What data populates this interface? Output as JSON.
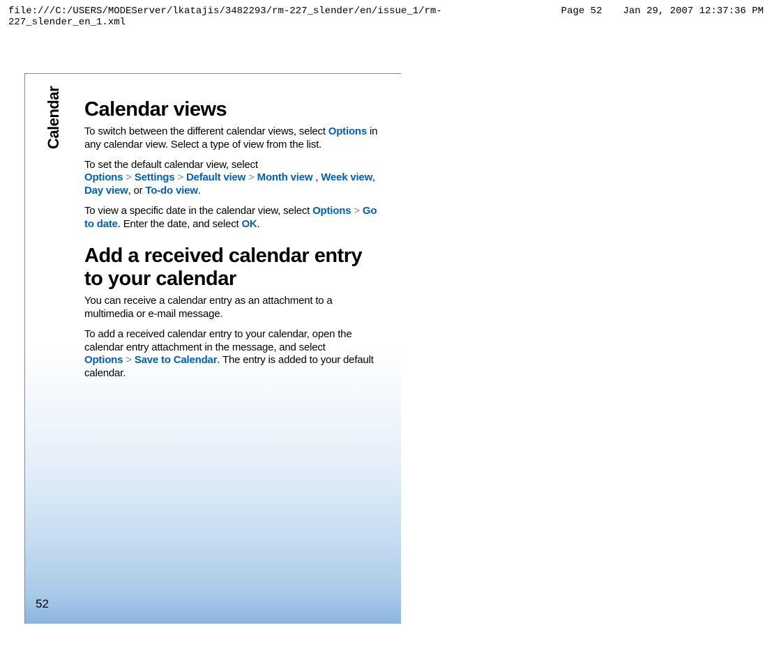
{
  "header": {
    "file_path": "file:///C:/USERS/MODEServer/lkatajis/3482293/rm-227_slender/en/issue_1/rm-227_slender_en_1.xml",
    "page_label": "Page 52",
    "timestamp": "Jan 29, 2007 12:37:36 PM"
  },
  "side_label": "Calendar",
  "page_number": "52",
  "sections": {
    "calendar_views": {
      "heading": "Calendar views",
      "p1_text1": "To switch between the different calendar views, select ",
      "p1_hl1": "Options",
      "p1_text2": " in any calendar view. Select a type of view from the list.",
      "p2_text1": "To set the default calendar view, select ",
      "p2_hl1": "Options",
      "p2_sep1": ">",
      "p2_hl2": "Settings",
      "p2_sep2": ">",
      "p2_hl3": "Default view",
      "p2_sep3": ">",
      "p2_hl4": "Month view",
      "p2_text2": " , ",
      "p2_hl5": "Week view",
      "p2_text3": ", ",
      "p2_hl6": "Day view",
      "p2_text4": ", or ",
      "p2_hl7": "To-do view",
      "p2_text5": ".",
      "p3_text1": "To view a specific date in the calendar view, select ",
      "p3_hl1": "Options",
      "p3_sep1": ">",
      "p3_hl2": "Go to date",
      "p3_text2": ". Enter the date, and select ",
      "p3_hl3": "OK",
      "p3_text3": "."
    },
    "add_received": {
      "heading": "Add a received calendar entry to your calendar",
      "p1_text1": "You can receive a calendar entry as an attachment to a multimedia or e-mail message.",
      "p2_text1": "To add a received calendar entry to your calendar, open the calendar entry attachment in the message, and select ",
      "p2_hl1": "Options",
      "p2_sep1": ">",
      "p2_hl2": "Save to Calendar",
      "p2_text2": ". The entry is added to your default calendar."
    }
  }
}
